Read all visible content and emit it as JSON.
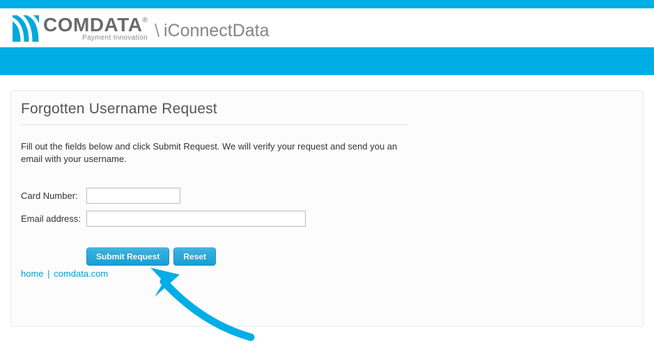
{
  "header": {
    "brand_main": "COMDATA",
    "brand_reg": "®",
    "brand_tag": "Payment Innovation",
    "product": "iConnectData"
  },
  "card": {
    "title": "Forgotten Username Request",
    "instructions": "Fill out the fields below and click Submit Request. We will verify your request and send you an email with your username.",
    "labels": {
      "card_number": "Card Number:",
      "email": "Email address:"
    },
    "values": {
      "card_number": "",
      "email": ""
    },
    "buttons": {
      "submit": "Submit Request",
      "reset": "Reset"
    },
    "links": {
      "home": "home",
      "comdata": "comdata.com",
      "sep": "|"
    }
  }
}
